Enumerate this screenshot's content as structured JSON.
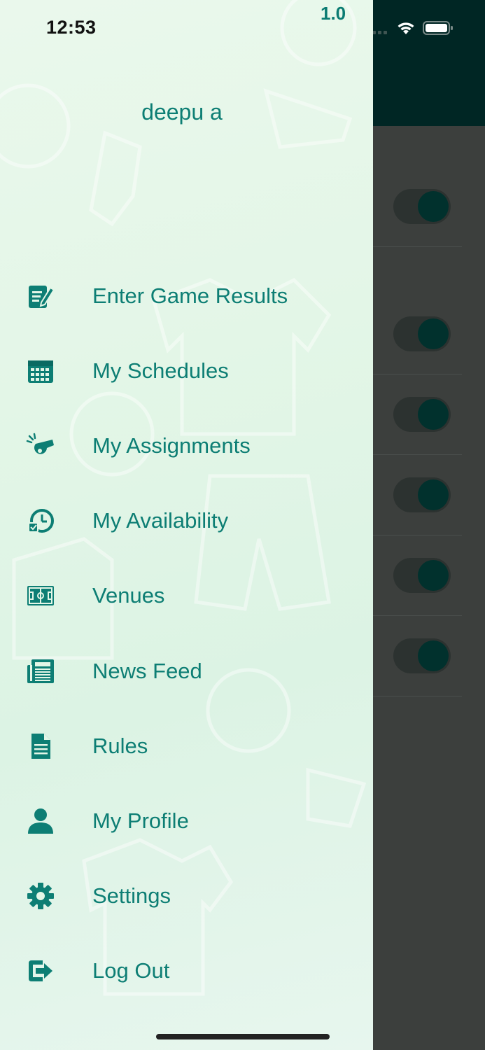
{
  "status_bar": {
    "time": "12:53",
    "version": "1.0"
  },
  "drawer": {
    "username": "deepu a",
    "items": [
      {
        "label": "Enter Game Results",
        "icon": "edit-document-icon"
      },
      {
        "label": "My Schedules",
        "icon": "calendar-icon"
      },
      {
        "label": "My Assignments",
        "icon": "whistle-icon"
      },
      {
        "label": "My Availability",
        "icon": "availability-clock-icon"
      },
      {
        "label": "Venues",
        "icon": "field-icon"
      },
      {
        "label": "News Feed",
        "icon": "newspaper-icon"
      },
      {
        "label": "Rules",
        "icon": "document-icon"
      },
      {
        "label": "My Profile",
        "icon": "user-icon"
      },
      {
        "label": "Settings",
        "icon": "gear-icon"
      },
      {
        "label": "Log Out",
        "icon": "logout-icon"
      }
    ]
  },
  "background_toggles": [
    {
      "state": "on"
    },
    {
      "state": "on"
    },
    {
      "state": "on"
    },
    {
      "state": "on"
    },
    {
      "state": "on"
    },
    {
      "state": "on"
    }
  ],
  "colors": {
    "accent": "#0d7e74",
    "header": "#002624",
    "drawer_bg": "#e3f6e7"
  }
}
